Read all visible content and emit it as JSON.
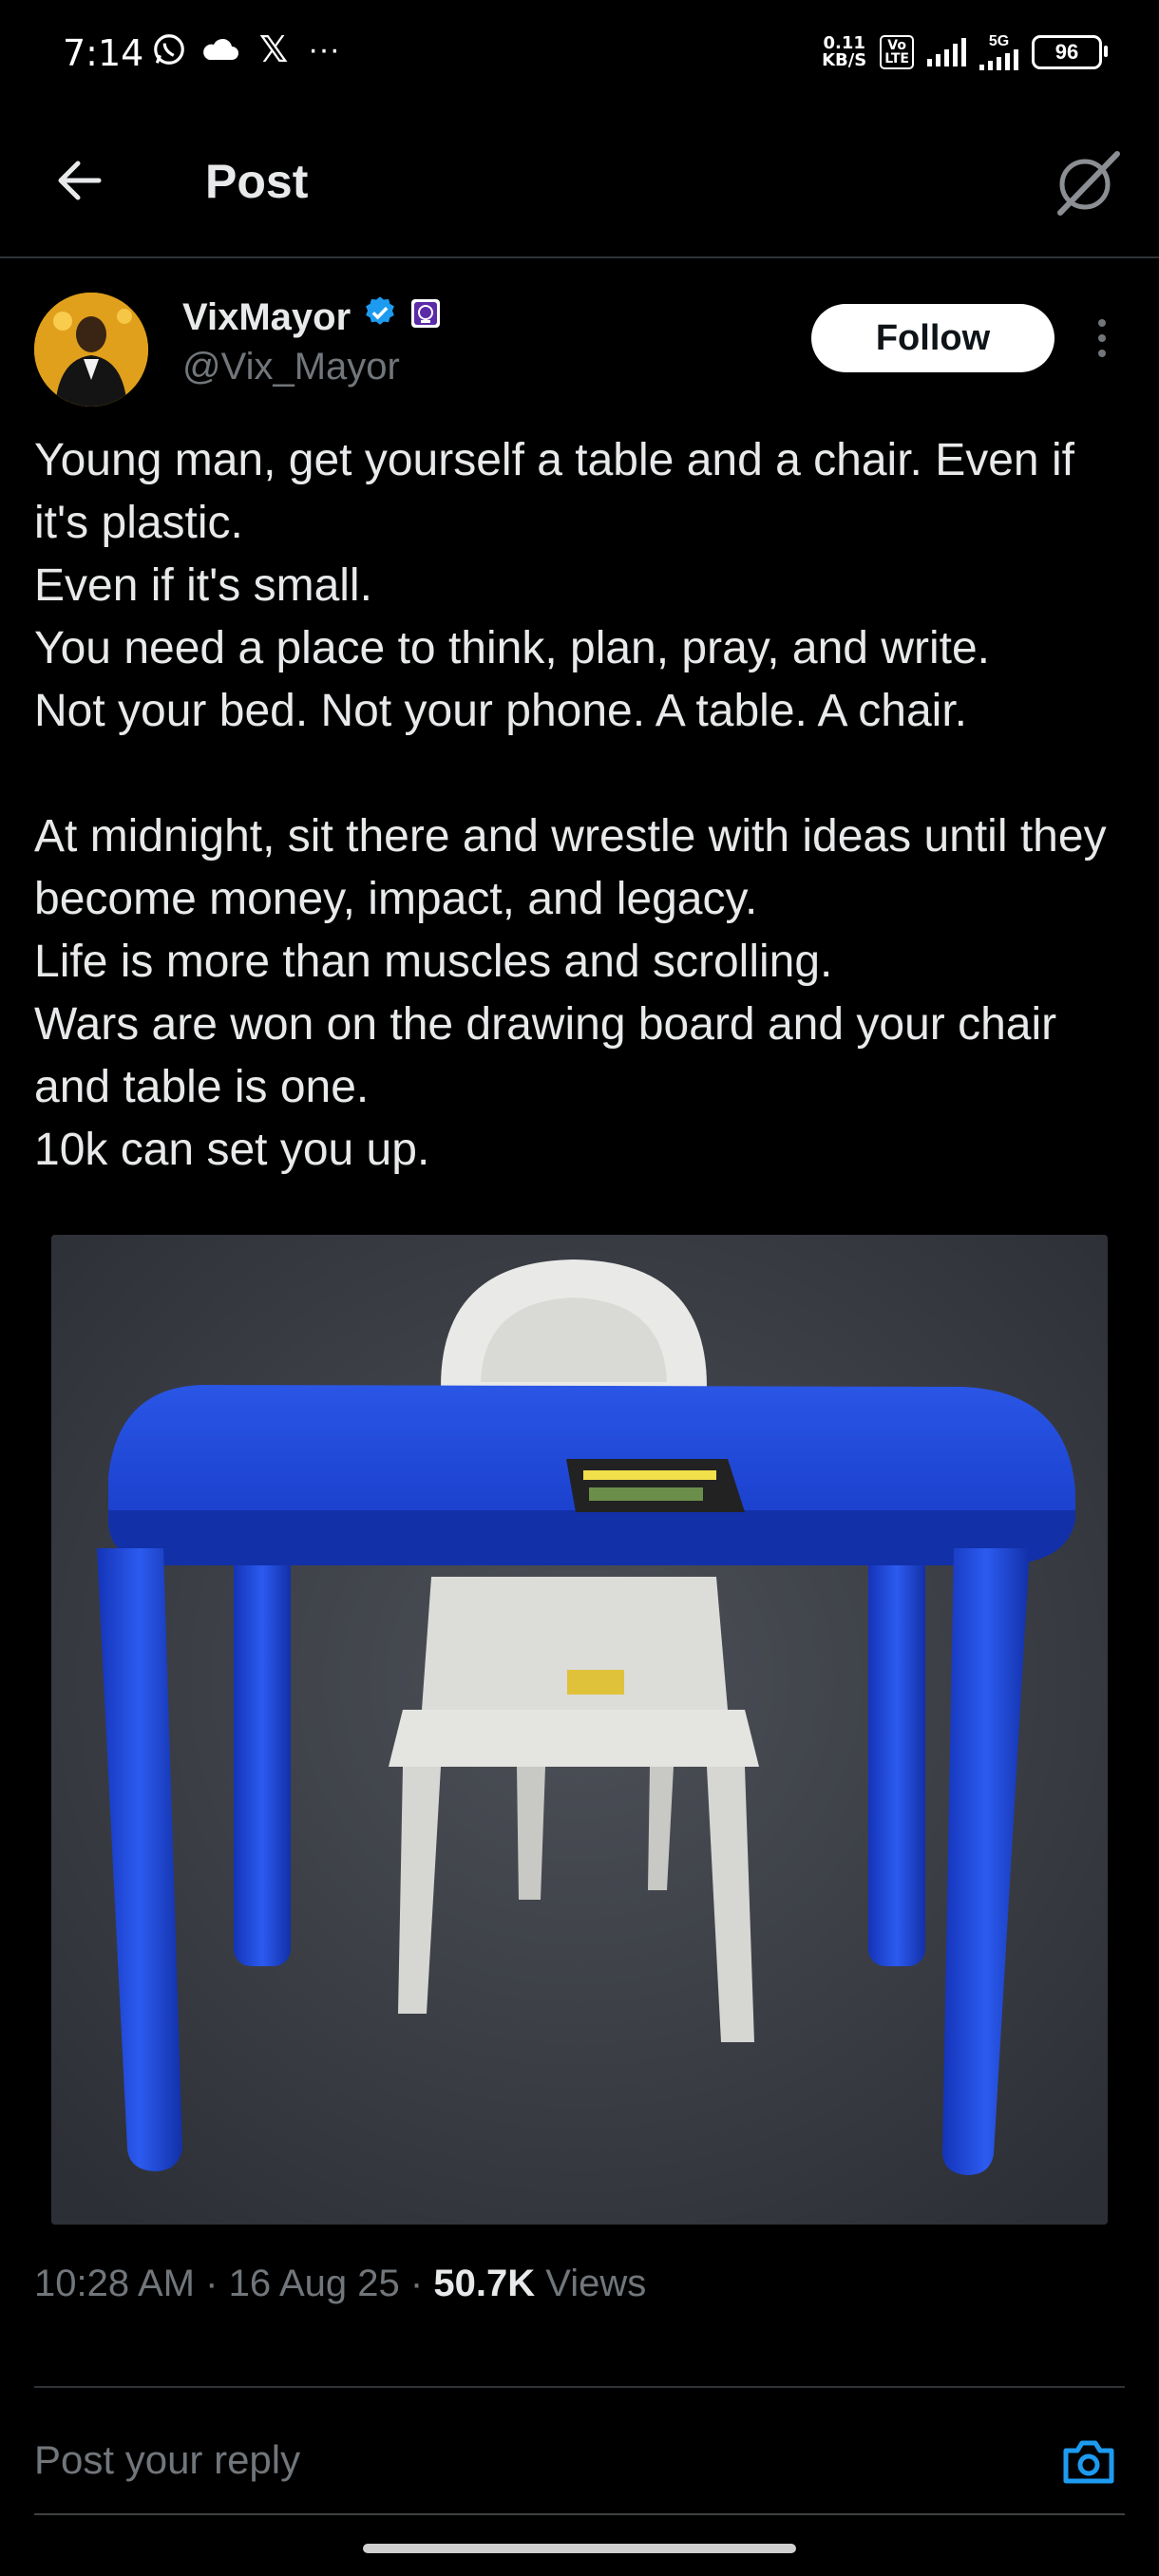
{
  "status_bar": {
    "time": "7:14",
    "net_speed_value": "0.11",
    "net_speed_unit": "KB/S",
    "volte_top": "Vo",
    "volte_bottom": "LTE",
    "network_type": "5G",
    "battery": "96",
    "icons": [
      "whatsapp-icon",
      "cloud-icon",
      "x-logo-icon",
      "more-notifications-icon"
    ]
  },
  "header": {
    "title": "Post"
  },
  "author": {
    "name": "VixMayor",
    "handle": "@Vix_Mayor",
    "follow_label": "Follow",
    "verified_color": "#1d9bf0"
  },
  "post": {
    "lines_1": [
      "Young man, get yourself a table and a chair. Even if it's plastic.",
      "Even if it's small.",
      "You need a place to think, plan, pray, and write.",
      "Not your bed. Not your phone. A table. A chair."
    ],
    "lines_2": [
      "At midnight, sit there and wrestle with ideas until they become money, impact, and legacy.",
      "Life is more than muscles and scrolling.",
      "Wars are won on the drawing board and your chair and table is one.",
      "10k can set you up."
    ],
    "image_subject": "blue plastic table with white plastic chair"
  },
  "meta": {
    "time": "10:28 AM",
    "date": "16 Aug 25",
    "views_count": "50.7K",
    "views_label": "Views",
    "separator": "·"
  },
  "reply": {
    "placeholder": "Post your reply"
  },
  "colors": {
    "background": "#000000",
    "text": "#e7e9ea",
    "muted": "#71767b",
    "accent": "#1d9bf0"
  }
}
